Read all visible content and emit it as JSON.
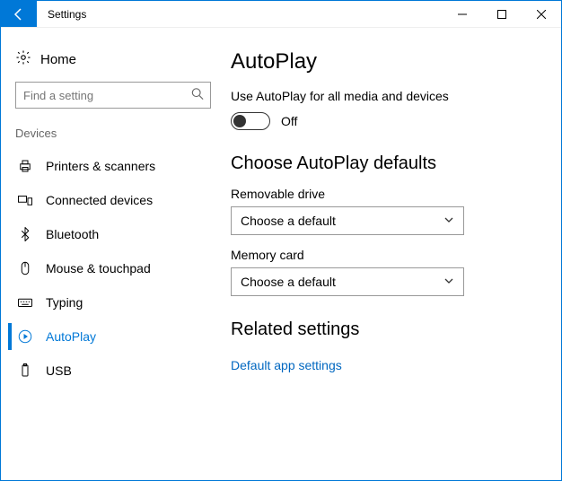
{
  "titlebar": {
    "title": "Settings"
  },
  "sidebar": {
    "home_label": "Home",
    "search_placeholder": "Find a setting",
    "section_label": "Devices",
    "items": [
      {
        "label": "Printers & scanners"
      },
      {
        "label": "Connected devices"
      },
      {
        "label": "Bluetooth"
      },
      {
        "label": "Mouse & touchpad"
      },
      {
        "label": "Typing"
      },
      {
        "label": "AutoPlay"
      },
      {
        "label": "USB"
      }
    ]
  },
  "main": {
    "page_title": "AutoPlay",
    "use_autoplay_label": "Use AutoPlay for all media and devices",
    "toggle_state": "Off",
    "defaults_heading": "Choose AutoPlay defaults",
    "removable_label": "Removable drive",
    "removable_value": "Choose a default",
    "memorycard_label": "Memory card",
    "memorycard_value": "Choose a default",
    "related_heading": "Related settings",
    "related_link": "Default app settings"
  }
}
